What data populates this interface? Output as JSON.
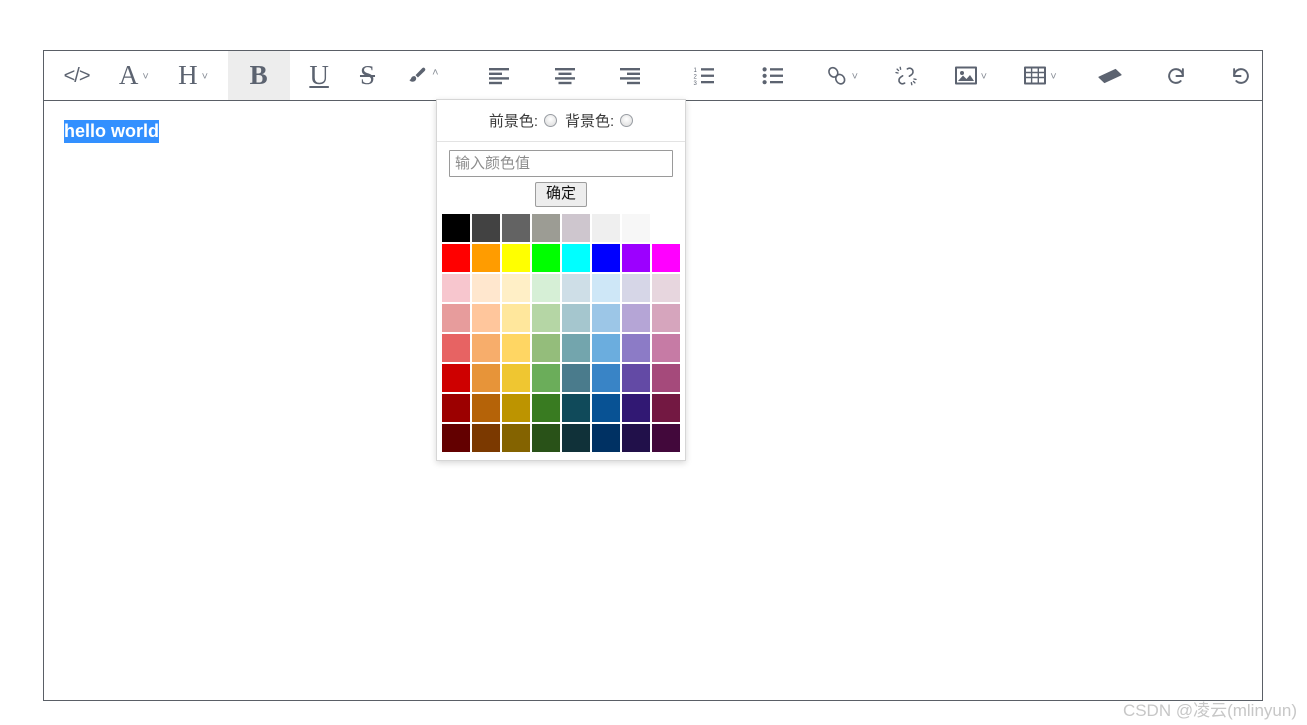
{
  "editor": {
    "toolbar": {
      "buttons": [
        {
          "name": "source-code-button",
          "icon": "code-icon",
          "label": "</>",
          "type": "text",
          "caret": "none",
          "active": false
        },
        {
          "name": "font-family-button",
          "icon": "font-letter-a-icon",
          "label": "A",
          "type": "text",
          "caret": "down",
          "active": false
        },
        {
          "name": "heading-button",
          "icon": "heading-h-icon",
          "label": "H",
          "type": "text",
          "caret": "down",
          "active": false
        },
        {
          "name": "bold-button",
          "icon": "bold-b-icon",
          "label": "B",
          "type": "text",
          "caret": "none",
          "active": true
        },
        {
          "name": "underline-button",
          "icon": "underline-u-icon",
          "label": "U",
          "type": "text",
          "caret": "none",
          "active": false
        },
        {
          "name": "strikethrough-button",
          "icon": "strikethrough-s-icon",
          "label": "S",
          "type": "text",
          "caret": "none",
          "active": false
        },
        {
          "name": "text-color-button",
          "icon": "brush-icon",
          "label": "",
          "type": "svg",
          "caret": "up",
          "active": false
        },
        {
          "name": "align-left-button",
          "icon": "align-left-icon",
          "label": "",
          "type": "svg",
          "caret": "none",
          "active": false
        },
        {
          "name": "align-center-button",
          "icon": "align-center-icon",
          "label": "",
          "type": "svg",
          "caret": "none",
          "active": false
        },
        {
          "name": "align-right-button",
          "icon": "align-right-icon",
          "label": "",
          "type": "svg",
          "caret": "none",
          "active": false
        },
        {
          "name": "ordered-list-button",
          "icon": "ordered-list-icon",
          "label": "",
          "type": "svg",
          "caret": "none",
          "active": false
        },
        {
          "name": "bullet-list-button",
          "icon": "bullet-list-icon",
          "label": "",
          "type": "svg",
          "caret": "none",
          "active": false
        },
        {
          "name": "insert-link-button",
          "icon": "link-icon",
          "label": "",
          "type": "svg",
          "caret": "down",
          "active": false
        },
        {
          "name": "unlink-button",
          "icon": "unlink-icon",
          "label": "",
          "type": "svg",
          "caret": "none",
          "active": false
        },
        {
          "name": "insert-image-button",
          "icon": "image-icon",
          "label": "",
          "type": "svg",
          "caret": "down",
          "active": false
        },
        {
          "name": "insert-table-button",
          "icon": "table-icon",
          "label": "",
          "type": "svg",
          "caret": "down",
          "active": false
        },
        {
          "name": "clear-format-button",
          "icon": "eraser-icon",
          "label": "",
          "type": "svg",
          "caret": "none",
          "active": false
        },
        {
          "name": "redo-button",
          "icon": "redo-icon",
          "label": "",
          "type": "svg",
          "caret": "none",
          "active": false
        },
        {
          "name": "undo-button",
          "icon": "undo-icon",
          "label": "",
          "type": "svg",
          "caret": "none",
          "active": false
        }
      ]
    },
    "content": {
      "selected_text": "hello world",
      "selection_color": "#3390ff"
    }
  },
  "color_panel": {
    "foreground_label": "前景色:",
    "background_label": "背景色:",
    "foreground_selected": false,
    "background_selected": false,
    "input_placeholder": "输入颜色值",
    "input_value": "",
    "confirm_label": "确定",
    "swatch_rows": [
      [
        "#000000",
        "#424242",
        "#636363",
        "#9c9c94",
        "#cec6ce",
        "#efefef",
        "#f7f7f7",
        "#ffffff"
      ],
      [
        "#ff0000",
        "#ff9c00",
        "#ffff00",
        "#00ff00",
        "#00ffff",
        "#0000ff",
        "#9c00ff",
        "#ff00ff"
      ],
      [
        "#f7c6ce",
        "#ffe7ce",
        "#ffefc6",
        "#d6efd6",
        "#cedee7",
        "#cee7f7",
        "#d6d6e7",
        "#e7d6de"
      ],
      [
        "#e79c9c",
        "#ffc69c",
        "#ffe79c",
        "#b5d6a5",
        "#a5c6ce",
        "#9cc6e7",
        "#b5a5d6",
        "#d6a5bd"
      ],
      [
        "#e76363",
        "#f7ad6b",
        "#ffd663",
        "#94bd7b",
        "#73a5ad",
        "#6badde",
        "#8c7bc6",
        "#c67ba5"
      ],
      [
        "#ce0000",
        "#e79439",
        "#efc631",
        "#6baD5a",
        "#4a7b8c",
        "#3984c6",
        "#634aa5",
        "#a54a7b"
      ],
      [
        "#9c0000",
        "#b56308",
        "#bd9400",
        "#397b21",
        "#104a5a",
        "#085294",
        "#311873",
        "#731842"
      ],
      [
        "#630000",
        "#7b3900",
        "#846300",
        "#295218",
        "#103139",
        "#003163",
        "#21104a",
        "#42083b"
      ]
    ]
  },
  "watermark": {
    "text": "CSDN @凌云(mlinyun)"
  }
}
